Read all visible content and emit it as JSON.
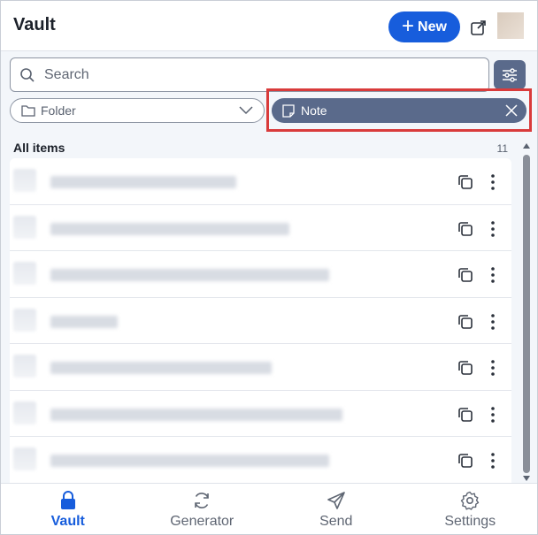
{
  "header": {
    "title": "Vault",
    "new_label": "New",
    "new_icon": "plus-icon",
    "popout_icon": "popout-icon"
  },
  "search": {
    "placeholder": "Search",
    "value": ""
  },
  "filters": {
    "folder_label": "Folder",
    "type_label": "Note"
  },
  "list": {
    "heading": "All items",
    "count": "11"
  },
  "nav": {
    "items": [
      {
        "label": "Vault",
        "icon": "lock-icon",
        "active": true
      },
      {
        "label": "Generator",
        "icon": "refresh-icon",
        "active": false
      },
      {
        "label": "Send",
        "icon": "send-icon",
        "active": false
      },
      {
        "label": "Settings",
        "icon": "gear-icon",
        "active": false
      }
    ]
  },
  "colors": {
    "brand": "#175ddc",
    "chip_active": "#5a6a8b",
    "highlight": "#d93b3b"
  }
}
